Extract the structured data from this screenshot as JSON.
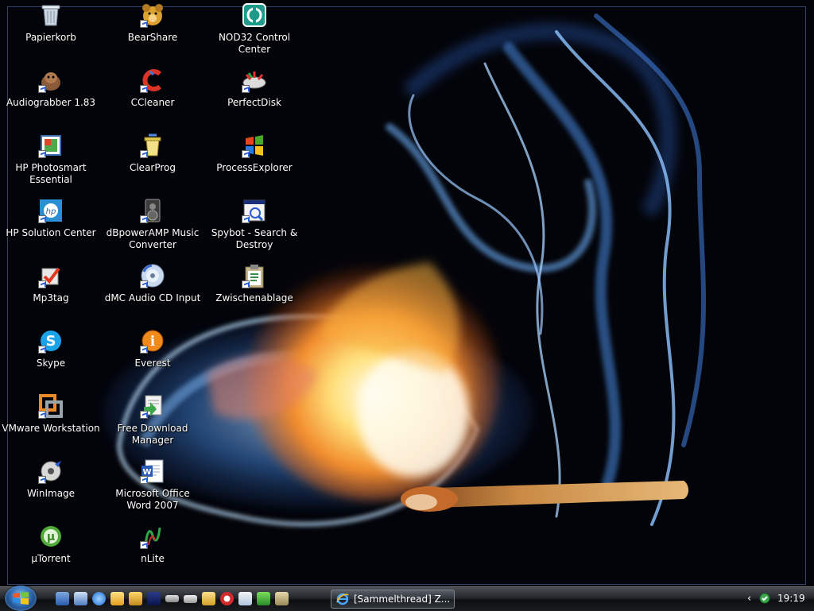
{
  "desktop": {
    "icons": [
      {
        "label": "Papierkorb",
        "icon": "recycle-bin-icon"
      },
      {
        "label": "Audiograbber 1.83",
        "icon": "audiograbber-icon"
      },
      {
        "label": "HP Photosmart Essential",
        "icon": "hp-photosmart-icon"
      },
      {
        "label": "HP Solution Center",
        "icon": "hp-solution-center-icon"
      },
      {
        "label": "Mp3tag",
        "icon": "mp3tag-icon"
      },
      {
        "label": "Skype",
        "icon": "skype-icon"
      },
      {
        "label": "VMware Workstation",
        "icon": "vmware-icon"
      },
      {
        "label": "WinImage",
        "icon": "winimage-icon"
      },
      {
        "label": "µTorrent",
        "icon": "utorrent-icon"
      },
      {
        "label": "BearShare",
        "icon": "bearshare-icon"
      },
      {
        "label": "CCleaner",
        "icon": "ccleaner-icon"
      },
      {
        "label": "ClearProg",
        "icon": "clearprog-icon"
      },
      {
        "label": "dBpowerAMP Music Converter",
        "icon": "dbpoweramp-icon"
      },
      {
        "label": "dMC Audio CD Input",
        "icon": "audio-cd-icon"
      },
      {
        "label": "Everest",
        "icon": "everest-icon"
      },
      {
        "label": "Free Download Manager",
        "icon": "download-manager-icon"
      },
      {
        "label": "Microsoft Office Word 2007",
        "icon": "word-icon"
      },
      {
        "label": "nLite",
        "icon": "nlite-icon"
      },
      {
        "label": "NOD32 Control Center",
        "icon": "nod32-icon"
      },
      {
        "label": "PerfectDisk",
        "icon": "perfectdisk-icon"
      },
      {
        "label": "ProcessExplorer",
        "icon": "processexplorer-icon"
      },
      {
        "label": "Spybot - Search & Destroy",
        "icon": "spybot-icon"
      },
      {
        "label": "Zwischenablage",
        "icon": "clipboard-icon"
      }
    ]
  },
  "taskbar": {
    "start_icon": "windows-logo-icon",
    "quick_launch": [
      "show-desktop-icon",
      "my-computer-icon",
      "internet-explorer-icon",
      "mail-icon",
      "tool-icon",
      "floppy-icon",
      "drive-icon",
      "printer-icon",
      "folder-icon",
      "opera-icon",
      "notepad-icon",
      "media-icon",
      "camera-icon"
    ],
    "window_button": "[Sammelthread] Z...",
    "tray_chevron": "‹",
    "clock": "19:19"
  },
  "colors": {
    "background": "#03040a",
    "label_text": "#ffffff",
    "taskbar": "#1a1d21"
  }
}
